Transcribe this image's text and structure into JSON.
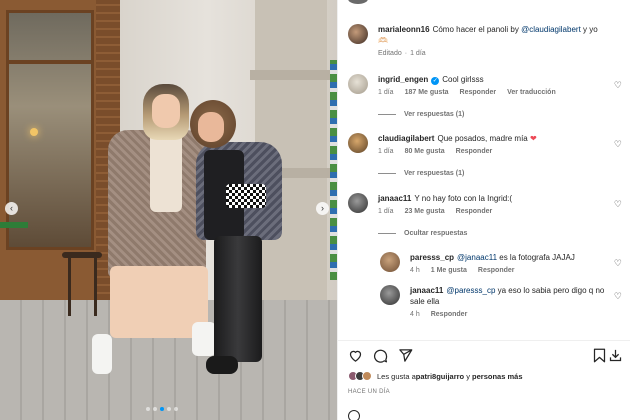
{
  "post": {
    "carousel_dots": 5,
    "active_dot": 2
  },
  "caption": {
    "username": "marialeonn16",
    "text_before": "Cómo hacer el panoli by ",
    "mention": "@claudiagilabert",
    "text_after": " y yo",
    "emoji": "🫶🏻",
    "edited": "Editado",
    "dot": "·",
    "time": "1 día"
  },
  "comments": [
    {
      "username": "ingrid_engen",
      "verified": true,
      "text": "Cool girlsss",
      "time": "1 día",
      "likes": "187 Me gusta",
      "reply": "Responder",
      "translate": "Ver traducción",
      "view_replies": "Ver respuestas (1)"
    },
    {
      "username": "claudiagilabert",
      "text": "Que posados, madre mía",
      "heart": "❤",
      "time": "1 día",
      "likes": "80 Me gusta",
      "reply": "Responder",
      "view_replies": "Ver respuestas (1)"
    },
    {
      "username": "janaac11",
      "text": "Y no hay foto con la Ingrid:(",
      "time": "1 día",
      "likes": "23 Me gusta",
      "reply": "Responder",
      "hide_replies": "Ocultar respuestas"
    }
  ],
  "replies": [
    {
      "username": "paresss_cp",
      "mention": "@janaac11",
      "text": " es la fotografa JAJAJ",
      "time": "4 h",
      "likes": "1 Me gusta",
      "reply": "Responder"
    },
    {
      "username": "janaac11",
      "mention": "@paresss_cp",
      "text": " ya eso lo sabia pero digo q no sale ella",
      "time": "4 h",
      "reply": "Responder"
    }
  ],
  "footer": {
    "likes_prefix": "Les gusta a ",
    "likes_user": "patri8guijarro",
    "likes_suffix": " y ",
    "likes_others": "personas más",
    "timestamp": "HACE UN DÍA"
  },
  "icons": {
    "like": "heart-outline-icon",
    "comment": "comment-icon",
    "share": "share-icon",
    "save": "bookmark-icon",
    "more": "more-options-icon",
    "verified": "verified-badge-icon"
  },
  "colors": {
    "link": "#00376b",
    "verified": "#0095f6",
    "meta": "#737373",
    "heart": "#ed4956"
  }
}
